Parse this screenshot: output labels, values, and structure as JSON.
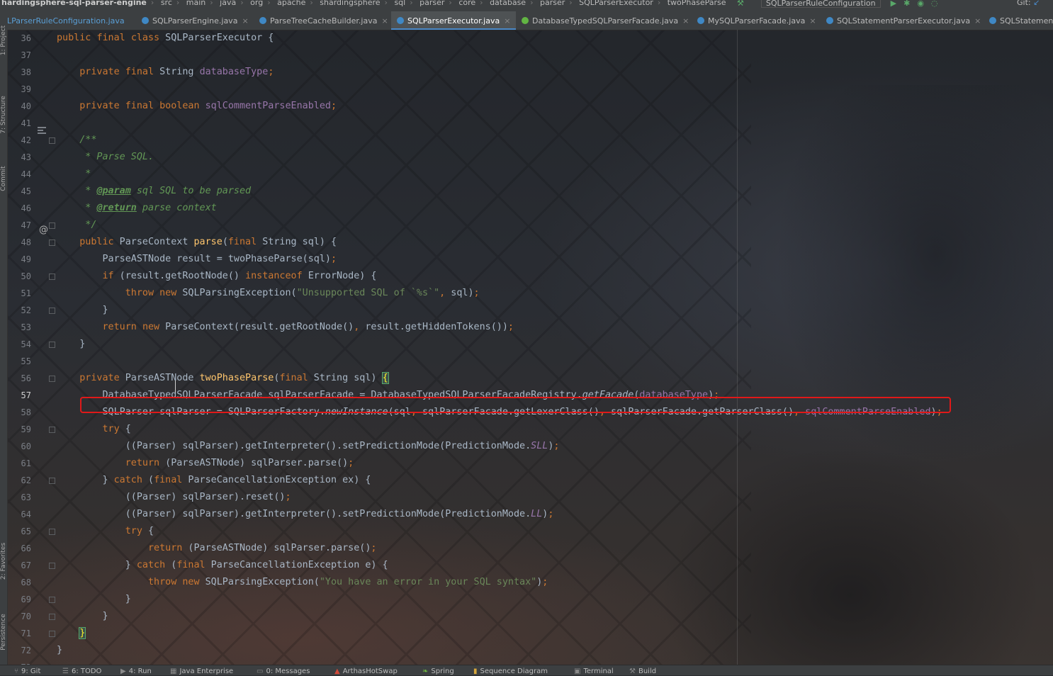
{
  "breadcrumbs": [
    "hardingsphere-sql-parser-engine",
    "src",
    "main",
    "java",
    "org",
    "apache",
    "shardingsphere",
    "sql",
    "parser",
    "core",
    "database",
    "parser",
    "SQLParserExecutor",
    "twoPhaseParse"
  ],
  "run_config": "SQLParserRuleConfiguration",
  "vcs_label": "Git:",
  "tabs": [
    {
      "label": "LParserRuleConfiguration.java"
    },
    {
      "label": "SQLParserEngine.java"
    },
    {
      "label": "ParseTreeCacheBuilder.java"
    },
    {
      "label": "SQLParserExecutor.java"
    },
    {
      "label": "DatabaseTypedSQLParserFacade.java"
    },
    {
      "label": "MySQLParserFacade.java"
    },
    {
      "label": "SQLStatementParserExecutor.java"
    },
    {
      "label": "SQLStatemen"
    }
  ],
  "tool_windows_left": [
    "1: Project",
    "7: Structure",
    "Commit",
    "2: Favorites",
    "Persistence"
  ],
  "tool_windows_bottom": [
    "9: Git",
    "6: TODO",
    "4: Run",
    "Java Enterprise",
    "0: Messages",
    "ArthasHotSwap",
    "Spring",
    "Sequence Diagram",
    "Terminal",
    "Build"
  ],
  "editor": {
    "current_line": "57",
    "lines": [
      {
        "n": "36",
        "text": "public final class SQLParserExecutor {"
      },
      {
        "n": "37",
        "text": ""
      },
      {
        "n": "38",
        "text": "    private final String databaseType;"
      },
      {
        "n": "39",
        "text": ""
      },
      {
        "n": "40",
        "text": "    private final boolean sqlCommentParseEnabled;"
      },
      {
        "n": "41",
        "text": ""
      },
      {
        "n": "42",
        "text": "    /**"
      },
      {
        "n": "43",
        "text": "     * Parse SQL."
      },
      {
        "n": "44",
        "text": "     *"
      },
      {
        "n": "45",
        "text": "     * @param sql SQL to be parsed"
      },
      {
        "n": "46",
        "text": "     * @return parse context"
      },
      {
        "n": "47",
        "text": "     */"
      },
      {
        "n": "48",
        "text": "    public ParseContext parse(final String sql) {"
      },
      {
        "n": "49",
        "text": "        ParseASTNode result = twoPhaseParse(sql);"
      },
      {
        "n": "50",
        "text": "        if (result.getRootNode() instanceof ErrorNode) {"
      },
      {
        "n": "51",
        "text": "            throw new SQLParsingException(\"Unsupported SQL of `%s`\", sql);"
      },
      {
        "n": "52",
        "text": "        }"
      },
      {
        "n": "53",
        "text": "        return new ParseContext(result.getRootNode(), result.getHiddenTokens());"
      },
      {
        "n": "54",
        "text": "    }"
      },
      {
        "n": "55",
        "text": ""
      },
      {
        "n": "56",
        "text": "    private ParseASTNode twoPhaseParse(final String sql) {"
      },
      {
        "n": "57",
        "text": "        DatabaseTypedSQLParserFacade sqlParserFacade = DatabaseTypedSQLParserFacadeRegistry.getFacade(databaseType);"
      },
      {
        "n": "58",
        "text": "        SQLParser sqlParser = SQLParserFactory.newInstance(sql, sqlParserFacade.getLexerClass(), sqlParserFacade.getParserClass(), sqlCommentParseEnabled);"
      },
      {
        "n": "59",
        "text": "        try {"
      },
      {
        "n": "60",
        "text": "            ((Parser) sqlParser).getInterpreter().setPredictionMode(PredictionMode.SLL);"
      },
      {
        "n": "61",
        "text": "            return (ParseASTNode) sqlParser.parse();"
      },
      {
        "n": "62",
        "text": "        } catch (final ParseCancellationException ex) {"
      },
      {
        "n": "63",
        "text": "            ((Parser) sqlParser).reset();"
      },
      {
        "n": "64",
        "text": "            ((Parser) sqlParser).getInterpreter().setPredictionMode(PredictionMode.LL);"
      },
      {
        "n": "65",
        "text": "            try {"
      },
      {
        "n": "66",
        "text": "                return (ParseASTNode) sqlParser.parse();"
      },
      {
        "n": "67",
        "text": "            } catch (final ParseCancellationException e) {"
      },
      {
        "n": "68",
        "text": "                throw new SQLParsingException(\"You have an error in your SQL syntax\");"
      },
      {
        "n": "69",
        "text": "            }"
      },
      {
        "n": "70",
        "text": "        }"
      },
      {
        "n": "71",
        "text": "    }"
      },
      {
        "n": "72",
        "text": "}"
      },
      {
        "n": "73",
        "text": ""
      }
    ]
  },
  "highlighted_line": "58",
  "highlight_color": "#e01919",
  "colors": {
    "keyword": "#cc7832",
    "field": "#9876aa",
    "method_decl": "#ffc66d",
    "string": "#6a8759",
    "comment": "#629755",
    "plain": "#a9b7c6"
  }
}
